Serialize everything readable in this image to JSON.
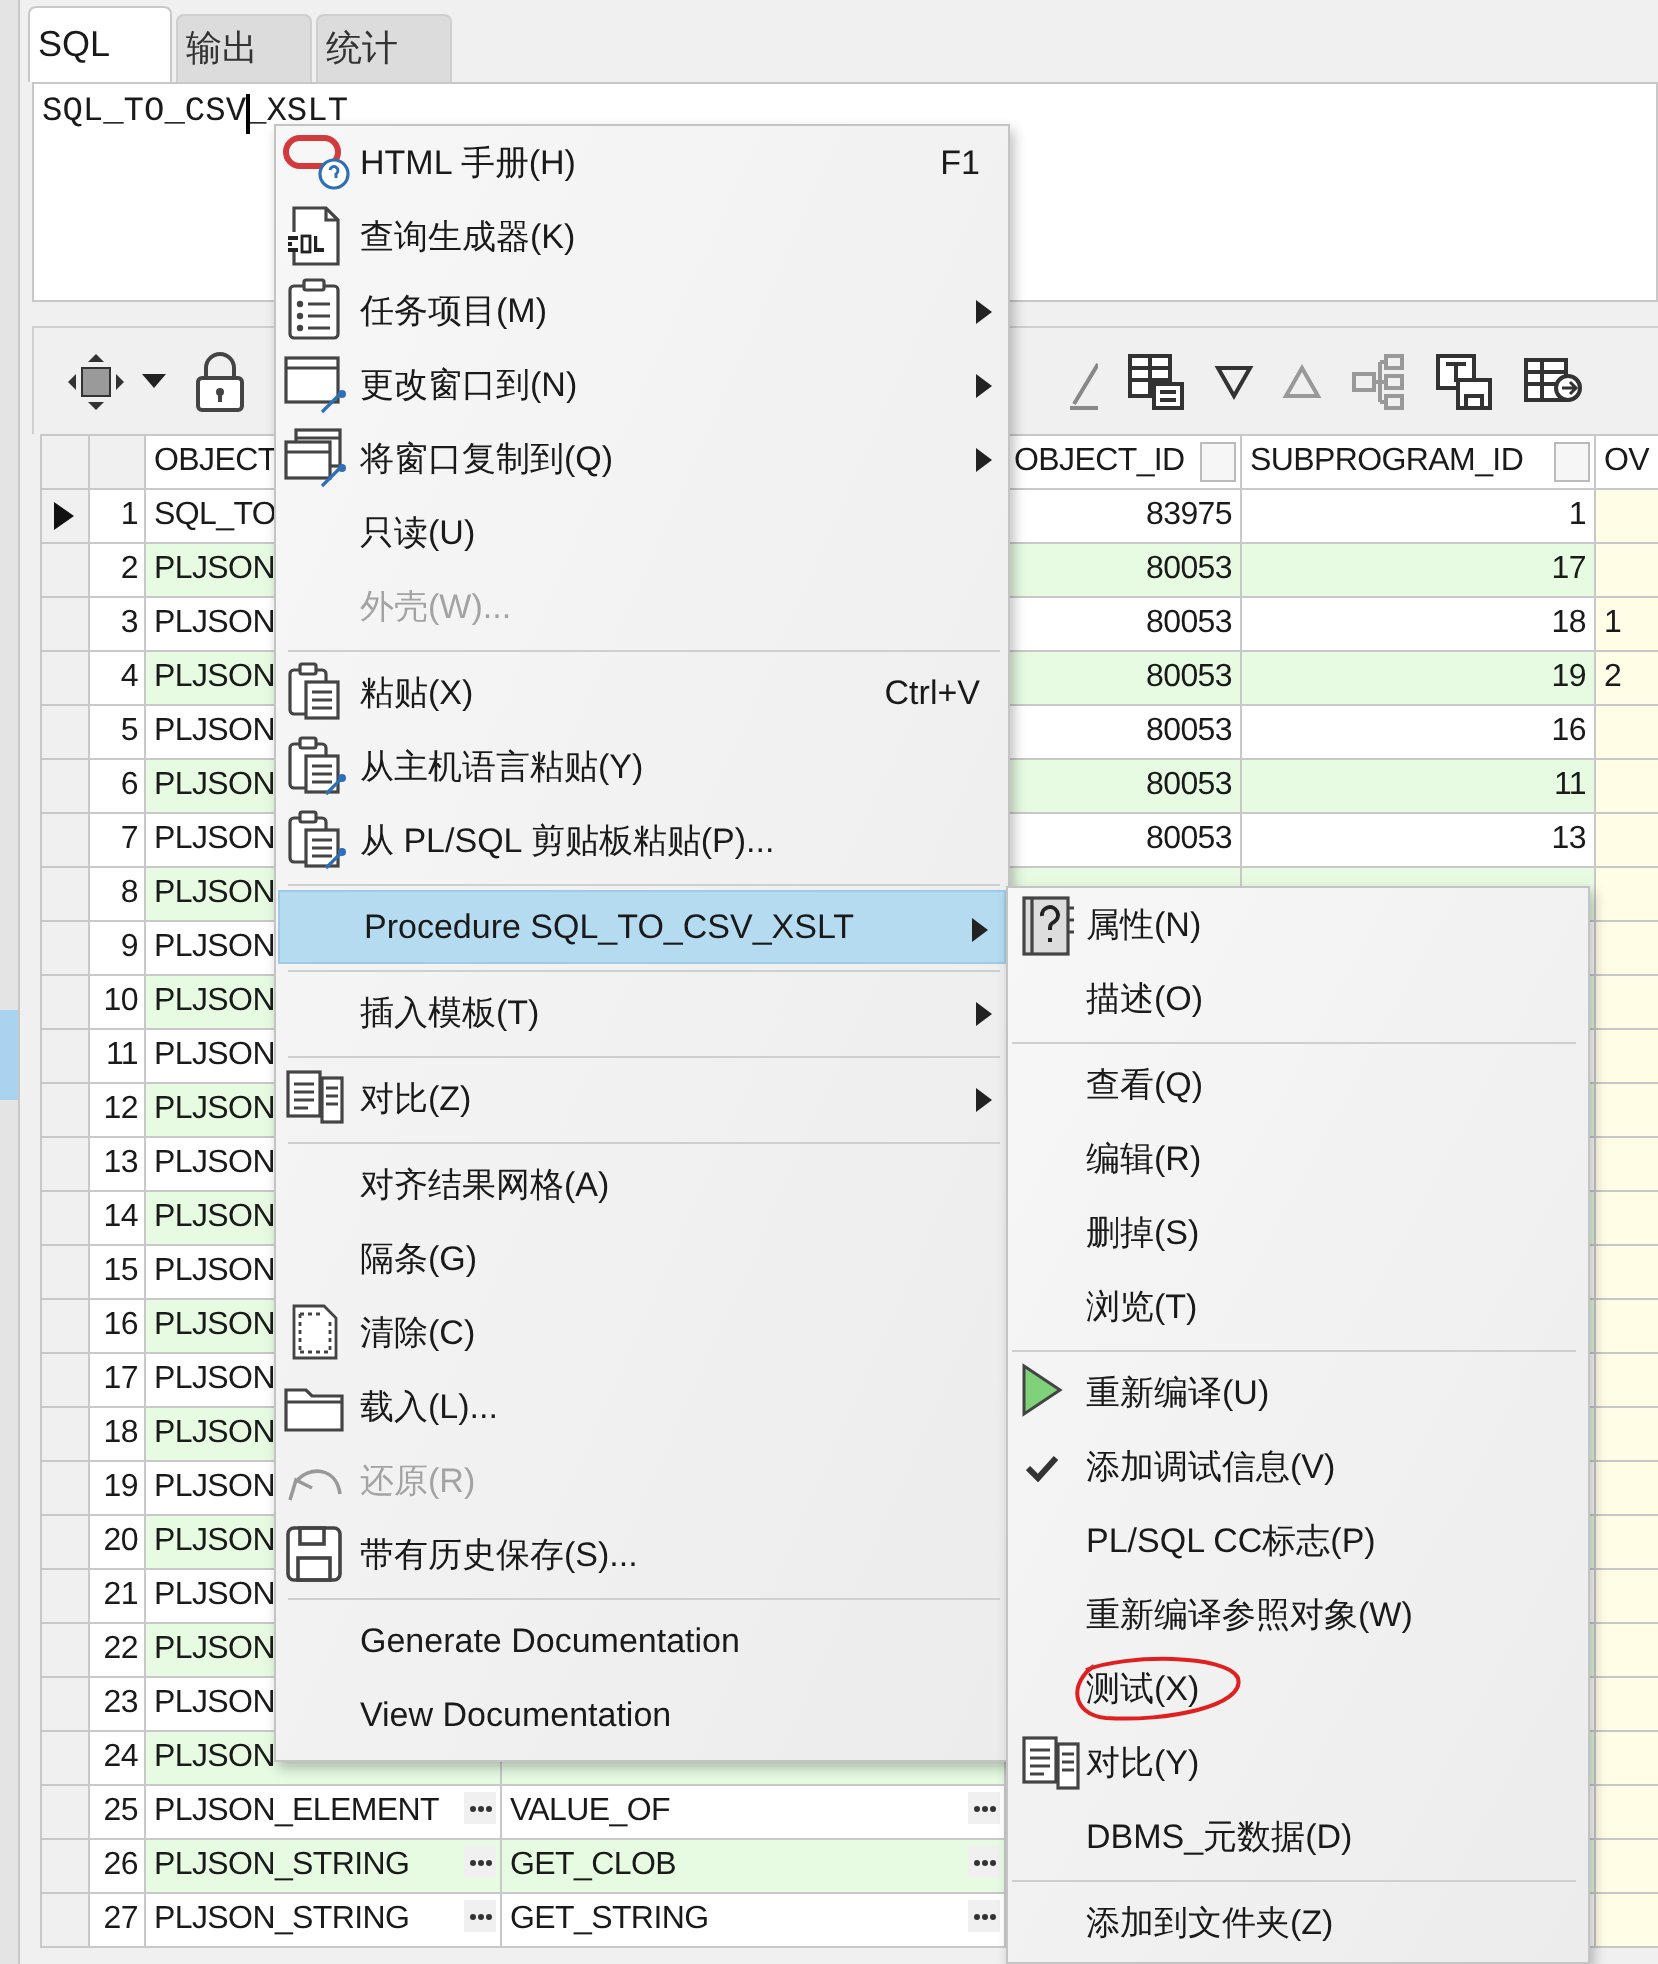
{
  "tabs": [
    {
      "label": "SQL",
      "selected": true
    },
    {
      "label": "输出",
      "selected": false
    },
    {
      "label": "统计",
      "selected": false
    }
  ],
  "editor": {
    "text": "SQL_TO_CSV_XSLT"
  },
  "grid": {
    "header": {
      "column_1": "OBJECT",
      "column_3": "OBJECT_ID",
      "column_4": "SUBPROGRAM_ID",
      "column_5": "OV"
    },
    "rows": [
      {
        "number": "1",
        "current": true,
        "column_1": "SQL_TO",
        "column_3": "83975",
        "column_4": "1"
      },
      {
        "number": "2",
        "current": false,
        "column_1": "PLJSON",
        "column_3": "80053",
        "column_4": "17"
      },
      {
        "number": "3",
        "current": false,
        "column_1": "PLJSON",
        "column_3": "80053",
        "column_4": "18",
        "column_5": "1"
      },
      {
        "number": "4",
        "current": false,
        "column_1": "PLJSON",
        "column_3": "80053",
        "column_4": "19",
        "column_5": "2"
      },
      {
        "number": "5",
        "current": false,
        "column_1": "PLJSON",
        "column_3": "80053",
        "column_4": "16"
      },
      {
        "number": "6",
        "current": false,
        "column_1": "PLJSON",
        "column_3": "80053",
        "column_4": "11"
      },
      {
        "number": "7",
        "current": false,
        "column_1": "PLJSON",
        "column_3": "80053",
        "column_4": "13"
      },
      {
        "number": "8",
        "current": false,
        "column_1": "PLJSON"
      },
      {
        "number": "9",
        "current": false,
        "column_1": "PLJSON"
      },
      {
        "number": "10",
        "current": false,
        "column_1": "PLJSON"
      },
      {
        "number": "11",
        "current": false,
        "column_1": "PLJSON"
      },
      {
        "number": "12",
        "current": false,
        "column_1": "PLJSON"
      },
      {
        "number": "13",
        "current": false,
        "column_1": "PLJSON"
      },
      {
        "number": "14",
        "current": false,
        "column_1": "PLJSON"
      },
      {
        "number": "15",
        "current": false,
        "column_1": "PLJSON"
      },
      {
        "number": "16",
        "current": false,
        "column_1": "PLJSON"
      },
      {
        "number": "17",
        "current": false,
        "column_1": "PLJSON"
      },
      {
        "number": "18",
        "current": false,
        "column_1": "PLJSON"
      },
      {
        "number": "19",
        "current": false,
        "column_1": "PLJSON"
      },
      {
        "number": "20",
        "current": false,
        "column_1": "PLJSON"
      },
      {
        "number": "21",
        "current": false,
        "column_1": "PLJSON"
      },
      {
        "number": "22",
        "current": false,
        "column_1": "PLJSON"
      },
      {
        "number": "23",
        "current": false,
        "column_1": "PLJSON"
      },
      {
        "number": "24",
        "current": false,
        "column_1": "PLJSON"
      },
      {
        "number": "25",
        "current": false,
        "cell_buttons": true,
        "column_1": "PLJSON_ELEMENT",
        "column_2": "VALUE_OF"
      },
      {
        "number": "26",
        "current": false,
        "cell_buttons": true,
        "column_1": "PLJSON_STRING",
        "column_2": "GET_CLOB"
      },
      {
        "number": "27",
        "current": false,
        "cell_buttons": true,
        "column_1": "PLJSON_STRING",
        "column_2": "GET_STRING"
      }
    ]
  },
  "context_menu": {
    "groups": [
      [
        {
          "label": "HTML 手册(H)",
          "shortcut": "F1",
          "has_submenu": false,
          "disabled": false,
          "selected": false
        },
        {
          "label": "查询生成器(K)",
          "has_submenu": false,
          "disabled": false,
          "selected": false
        },
        {
          "label": "任务项目(M)",
          "has_submenu": true,
          "disabled": false,
          "selected": false
        },
        {
          "label": "更改窗口到(N)",
          "has_submenu": true,
          "disabled": false,
          "selected": false
        },
        {
          "label": "将窗口复制到(Q)",
          "has_submenu": true,
          "disabled": false,
          "selected": false
        },
        {
          "label": "只读(U)",
          "has_submenu": false,
          "disabled": false,
          "selected": false
        },
        {
          "label": "外壳(W)...",
          "has_submenu": false,
          "disabled": true,
          "selected": false
        }
      ],
      [
        {
          "label": "粘贴(X)",
          "shortcut": "Ctrl+V",
          "has_submenu": false,
          "disabled": false,
          "selected": false
        },
        {
          "label": "从主机语言粘贴(Y)",
          "has_submenu": false,
          "disabled": false,
          "selected": false
        },
        {
          "label": "从 PL/SQL 剪贴板粘贴(P)...",
          "has_submenu": false,
          "disabled": false,
          "selected": false
        }
      ],
      [
        {
          "label": "Procedure SQL_TO_CSV_XSLT",
          "has_submenu": true,
          "disabled": false,
          "selected": true
        }
      ],
      [
        {
          "label": "插入模板(T)",
          "has_submenu": true,
          "disabled": false,
          "selected": false
        }
      ],
      [
        {
          "label": "对比(Z)",
          "has_submenu": true,
          "disabled": false,
          "selected": false
        }
      ],
      [
        {
          "label": "对齐结果网格(A)",
          "has_submenu": false,
          "disabled": false,
          "selected": false
        },
        {
          "label": "隔条(G)",
          "has_submenu": false,
          "disabled": false,
          "selected": false
        },
        {
          "label": "清除(C)",
          "has_submenu": false,
          "disabled": false,
          "selected": false
        },
        {
          "label": "载入(L)...",
          "has_submenu": false,
          "disabled": false,
          "selected": false
        },
        {
          "label": "还原(R)",
          "has_submenu": false,
          "disabled": true,
          "selected": false
        },
        {
          "label": "带有历史保存(S)...",
          "has_submenu": false,
          "disabled": false,
          "selected": false
        }
      ],
      [
        {
          "label": "Generate Documentation",
          "has_submenu": false,
          "disabled": false,
          "selected": false
        },
        {
          "label": "View Documentation",
          "has_submenu": false,
          "disabled": false,
          "selected": false
        }
      ]
    ]
  },
  "submenu": {
    "groups": [
      [
        {
          "label": "属性(N)",
          "checked": false,
          "circled": false
        },
        {
          "label": "描述(O)",
          "checked": false,
          "circled": false
        }
      ],
      [
        {
          "label": "查看(Q)",
          "checked": false,
          "circled": false
        },
        {
          "label": "编辑(R)",
          "checked": false,
          "circled": false
        },
        {
          "label": "删掉(S)",
          "checked": false,
          "circled": false
        },
        {
          "label": "浏览(T)",
          "checked": false,
          "circled": false
        }
      ],
      [
        {
          "label": "重新编译(U)",
          "checked": false,
          "circled": false
        },
        {
          "label": "添加调试信息(V)",
          "checked": true,
          "circled": false
        },
        {
          "label": "PL/SQL CC标志(P)",
          "checked": false,
          "circled": false
        },
        {
          "label": "重新编译参照对象(W)",
          "checked": false,
          "circled": false
        },
        {
          "label": "测试(X)",
          "checked": false,
          "circled": true
        },
        {
          "label": "对比(Y)",
          "checked": false,
          "circled": false
        },
        {
          "label": "DBMS_元数据(D)",
          "checked": false,
          "circled": false
        }
      ],
      [
        {
          "label": "添加到文件夹(Z)",
          "checked": false,
          "circled": false
        }
      ]
    ]
  }
}
